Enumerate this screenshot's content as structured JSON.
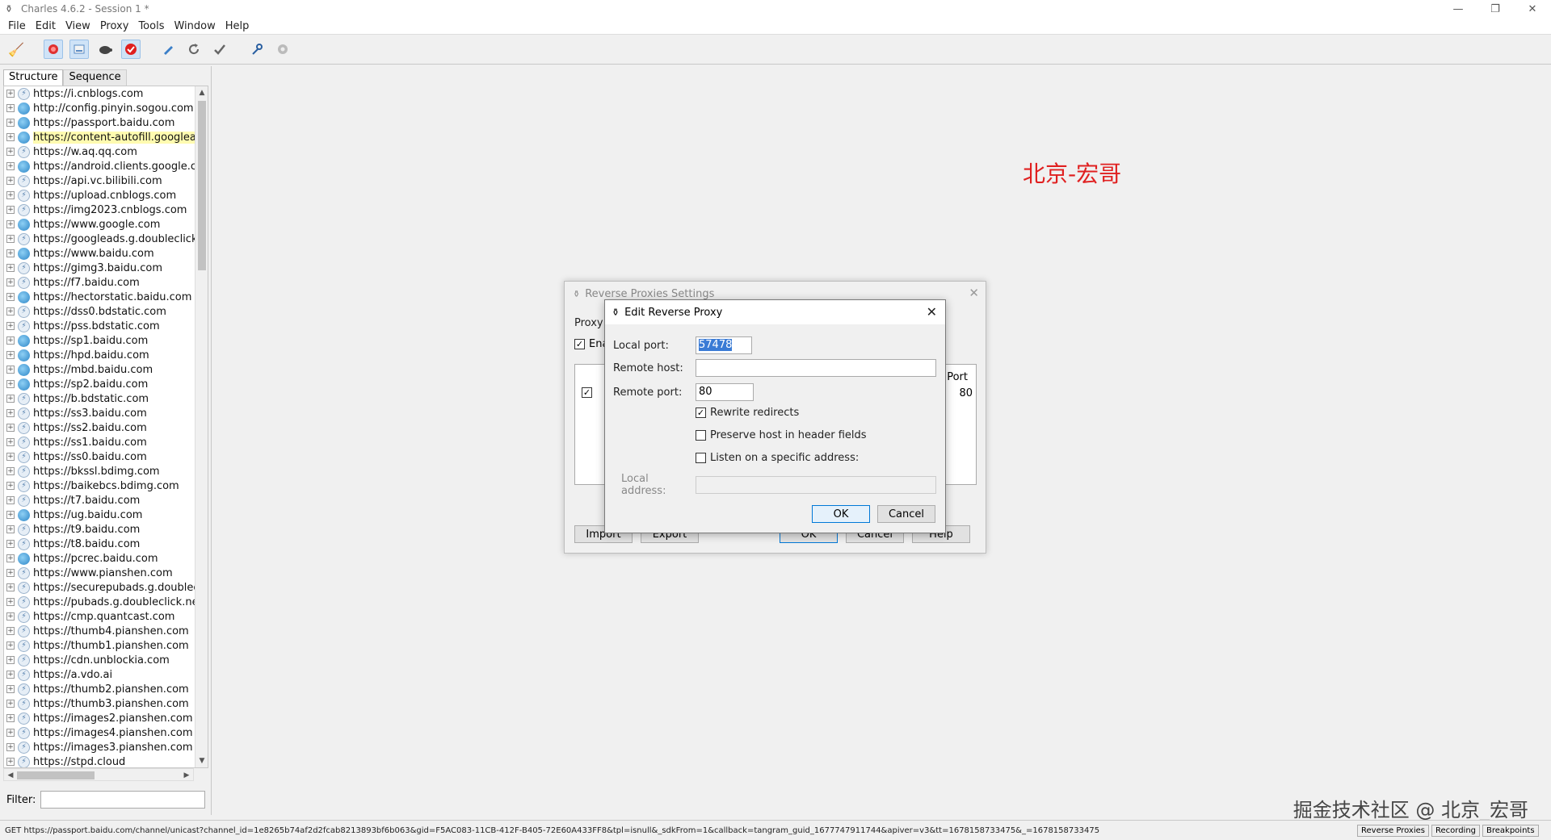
{
  "window": {
    "title": "Charles 4.6.2 - Session 1 *",
    "controls": [
      "—",
      "❐",
      "✕"
    ]
  },
  "menu": [
    "File",
    "Edit",
    "View",
    "Proxy",
    "Tools",
    "Window",
    "Help"
  ],
  "toolbar": {
    "icons": [
      "broom-icon",
      "record-icon",
      "throttle-icon",
      "turtle-icon",
      "breakpoint-icon",
      "compose-icon",
      "repeat-icon",
      "validate-icon",
      "tools-icon",
      "settings-icon"
    ]
  },
  "sidebar": {
    "tabs": [
      "Structure",
      "Sequence"
    ],
    "filter_label": "Filter:",
    "filter_value": "",
    "items": [
      {
        "url": "https://i.cnblogs.com",
        "icon": "lock"
      },
      {
        "url": "http://config.pinyin.sogou.com",
        "icon": "globe"
      },
      {
        "url": "https://passport.baidu.com",
        "icon": "globe"
      },
      {
        "url": "https://content-autofill.googleapis",
        "icon": "globe",
        "selected": true
      },
      {
        "url": "https://w.aq.qq.com",
        "icon": "lock"
      },
      {
        "url": "https://android.clients.google.com",
        "icon": "globe"
      },
      {
        "url": "https://api.vc.bilibili.com",
        "icon": "lock"
      },
      {
        "url": "https://upload.cnblogs.com",
        "icon": "lock"
      },
      {
        "url": "https://img2023.cnblogs.com",
        "icon": "lock"
      },
      {
        "url": "https://www.google.com",
        "icon": "globe"
      },
      {
        "url": "https://googleads.g.doubleclick.ne",
        "icon": "lock"
      },
      {
        "url": "https://www.baidu.com",
        "icon": "globe"
      },
      {
        "url": "https://gimg3.baidu.com",
        "icon": "lock"
      },
      {
        "url": "https://f7.baidu.com",
        "icon": "lock"
      },
      {
        "url": "https://hectorstatic.baidu.com",
        "icon": "globe"
      },
      {
        "url": "https://dss0.bdstatic.com",
        "icon": "lock"
      },
      {
        "url": "https://pss.bdstatic.com",
        "icon": "lock"
      },
      {
        "url": "https://sp1.baidu.com",
        "icon": "globe"
      },
      {
        "url": "https://hpd.baidu.com",
        "icon": "globe"
      },
      {
        "url": "https://mbd.baidu.com",
        "icon": "globe"
      },
      {
        "url": "https://sp2.baidu.com",
        "icon": "globe"
      },
      {
        "url": "https://b.bdstatic.com",
        "icon": "lock"
      },
      {
        "url": "https://ss3.baidu.com",
        "icon": "lock"
      },
      {
        "url": "https://ss2.baidu.com",
        "icon": "lock"
      },
      {
        "url": "https://ss1.baidu.com",
        "icon": "lock"
      },
      {
        "url": "https://ss0.baidu.com",
        "icon": "lock"
      },
      {
        "url": "https://bkssl.bdimg.com",
        "icon": "lock"
      },
      {
        "url": "https://baikebcs.bdimg.com",
        "icon": "lock"
      },
      {
        "url": "https://t7.baidu.com",
        "icon": "lock"
      },
      {
        "url": "https://ug.baidu.com",
        "icon": "globe"
      },
      {
        "url": "https://t9.baidu.com",
        "icon": "lock"
      },
      {
        "url": "https://t8.baidu.com",
        "icon": "lock"
      },
      {
        "url": "https://pcrec.baidu.com",
        "icon": "globe"
      },
      {
        "url": "https://www.pianshen.com",
        "icon": "lock"
      },
      {
        "url": "https://securepubads.g.doubleclic",
        "icon": "lock"
      },
      {
        "url": "https://pubads.g.doubleclick.net",
        "icon": "lock"
      },
      {
        "url": "https://cmp.quantcast.com",
        "icon": "lock"
      },
      {
        "url": "https://thumb4.pianshen.com",
        "icon": "lock"
      },
      {
        "url": "https://thumb1.pianshen.com",
        "icon": "lock"
      },
      {
        "url": "https://cdn.unblockia.com",
        "icon": "lock"
      },
      {
        "url": "https://a.vdo.ai",
        "icon": "lock"
      },
      {
        "url": "https://thumb2.pianshen.com",
        "icon": "lock"
      },
      {
        "url": "https://thumb3.pianshen.com",
        "icon": "lock"
      },
      {
        "url": "https://images2.pianshen.com",
        "icon": "lock"
      },
      {
        "url": "https://images4.pianshen.com",
        "icon": "lock"
      },
      {
        "url": "https://images3.pianshen.com",
        "icon": "lock"
      },
      {
        "url": "https://stpd.cloud",
        "icon": "lock"
      }
    ]
  },
  "main": {
    "overlay_text": "北京-宏哥",
    "watermark": "掘金技术社区 @ 北京_宏哥"
  },
  "reverse_proxies_dialog": {
    "title": "Reverse Proxies Settings",
    "proxy_label": "Proxy",
    "enable_label": "Ena",
    "enable_checked": true,
    "port_header": "Port",
    "port_value": "80",
    "row_checked": true,
    "buttons": {
      "import": "Import",
      "export": "Export",
      "ok": "OK",
      "cancel": "Cancel",
      "help": "Help"
    }
  },
  "edit_dialog": {
    "title": "Edit Reverse Proxy",
    "local_port_label": "Local port:",
    "local_port_value": "57478",
    "remote_host_label": "Remote host:",
    "remote_host_value": "",
    "remote_port_label": "Remote port:",
    "remote_port_value": "80",
    "rewrite_redirects_label": "Rewrite redirects",
    "rewrite_redirects_checked": true,
    "preserve_host_label": "Preserve host in header fields",
    "preserve_host_checked": false,
    "listen_specific_label": "Listen on a specific address:",
    "listen_specific_checked": false,
    "local_address_label": "Local address:",
    "local_address_value": "",
    "ok_label": "OK",
    "cancel_label": "Cancel"
  },
  "statusbar": {
    "request_text": "GET https://passport.baidu.com/channel/unicast?channel_id=1e8265b74af2d2fcab8213893bf6b063&gid=F5AC083-11CB-412F-B405-72E60A433FF8&tpl=isnull&_sdkFrom=1&callback=tangram_guid_1677747911744&apiver=v3&tt=1678158733475&_=1678158733475",
    "buttons": [
      "Reverse Proxies",
      "Recording",
      "Breakpoints"
    ]
  }
}
